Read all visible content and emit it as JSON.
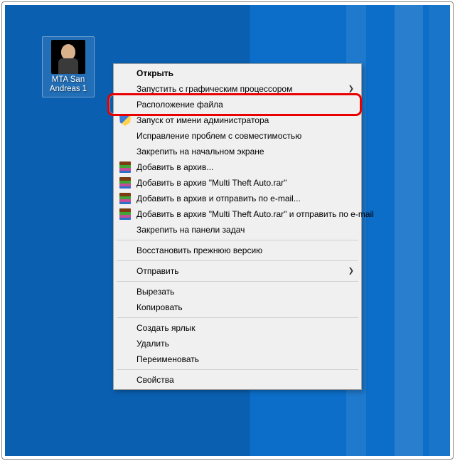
{
  "desktop": {
    "icon_label": "MTA San Andreas 1"
  },
  "menu": {
    "items": [
      {
        "label": "Открыть",
        "bold": true
      },
      {
        "label": "Запустить с графическим процессором",
        "submenu": true
      },
      {
        "label": "Расположение файла",
        "highlighted": true
      },
      {
        "label": "Запуск от имени администратора",
        "icon": "shield"
      },
      {
        "label": "Исправление проблем с совместимостью"
      },
      {
        "label": "Закрепить на начальном экране"
      },
      {
        "label": "Добавить в архив...",
        "icon": "rar"
      },
      {
        "label": "Добавить в архив \"Multi Theft Auto.rar\"",
        "icon": "rar"
      },
      {
        "label": "Добавить в архив и отправить по e-mail...",
        "icon": "rar"
      },
      {
        "label": "Добавить в архив \"Multi Theft Auto.rar\" и отправить по e-mail",
        "icon": "rar"
      },
      {
        "label": "Закрепить на панели задач"
      },
      {
        "sep": true
      },
      {
        "label": "Восстановить прежнюю версию"
      },
      {
        "sep": true
      },
      {
        "label": "Отправить",
        "submenu": true
      },
      {
        "sep": true
      },
      {
        "label": "Вырезать"
      },
      {
        "label": "Копировать"
      },
      {
        "sep": true
      },
      {
        "label": "Создать ярлык"
      },
      {
        "label": "Удалить"
      },
      {
        "label": "Переименовать"
      },
      {
        "sep": true
      },
      {
        "label": "Свойства"
      }
    ]
  }
}
